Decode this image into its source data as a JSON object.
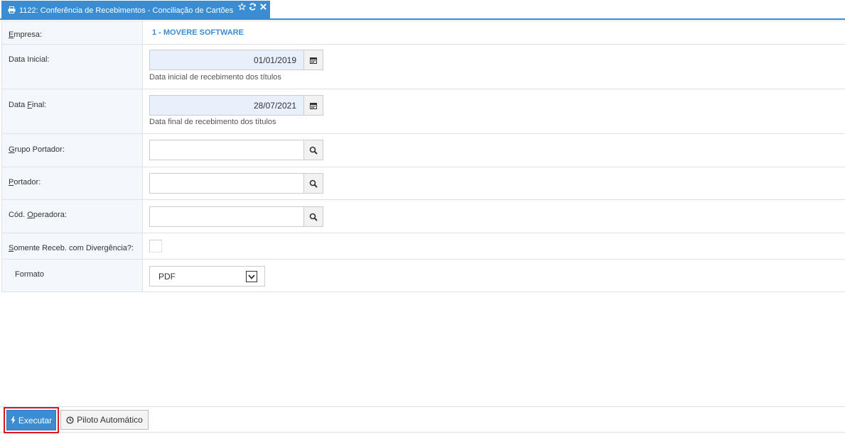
{
  "tab": {
    "title": "1122: Conferência de Recebimentos - Conciliação de Cartões"
  },
  "form": {
    "empresa": {
      "label_ul": "E",
      "label_rest": "mpresa:",
      "value": "1 - MOVERE SOFTWARE"
    },
    "data_inicial": {
      "label": "Data Inicial:",
      "value": "01/01/2019",
      "hint": "Data inicial de recebimento dos títulos"
    },
    "data_final": {
      "label_pre": "Data ",
      "label_ul": "F",
      "label_rest": "inal:",
      "value": "28/07/2021",
      "hint": "Data final de recebimento dos títulos"
    },
    "grupo_portador": {
      "label_ul": "G",
      "label_rest": "rupo Portador:",
      "value": ""
    },
    "portador": {
      "label_ul": "P",
      "label_rest": "ortador:",
      "value": ""
    },
    "cod_operadora": {
      "label_pre": "Cód. ",
      "label_ul": "O",
      "label_rest": "peradora:",
      "value": ""
    },
    "somente_divergencia": {
      "label_ul": "S",
      "label_rest": "omente Receb. com Divergência?:",
      "checked": false
    },
    "formato": {
      "label": "Formato",
      "selected": "PDF"
    }
  },
  "footer": {
    "execute_label": "Executar",
    "auto_label": "Piloto Automático"
  },
  "colors": {
    "accent": "#3a8dd3",
    "highlight": "#e0141c",
    "date_bg": "#e8f0fb"
  }
}
